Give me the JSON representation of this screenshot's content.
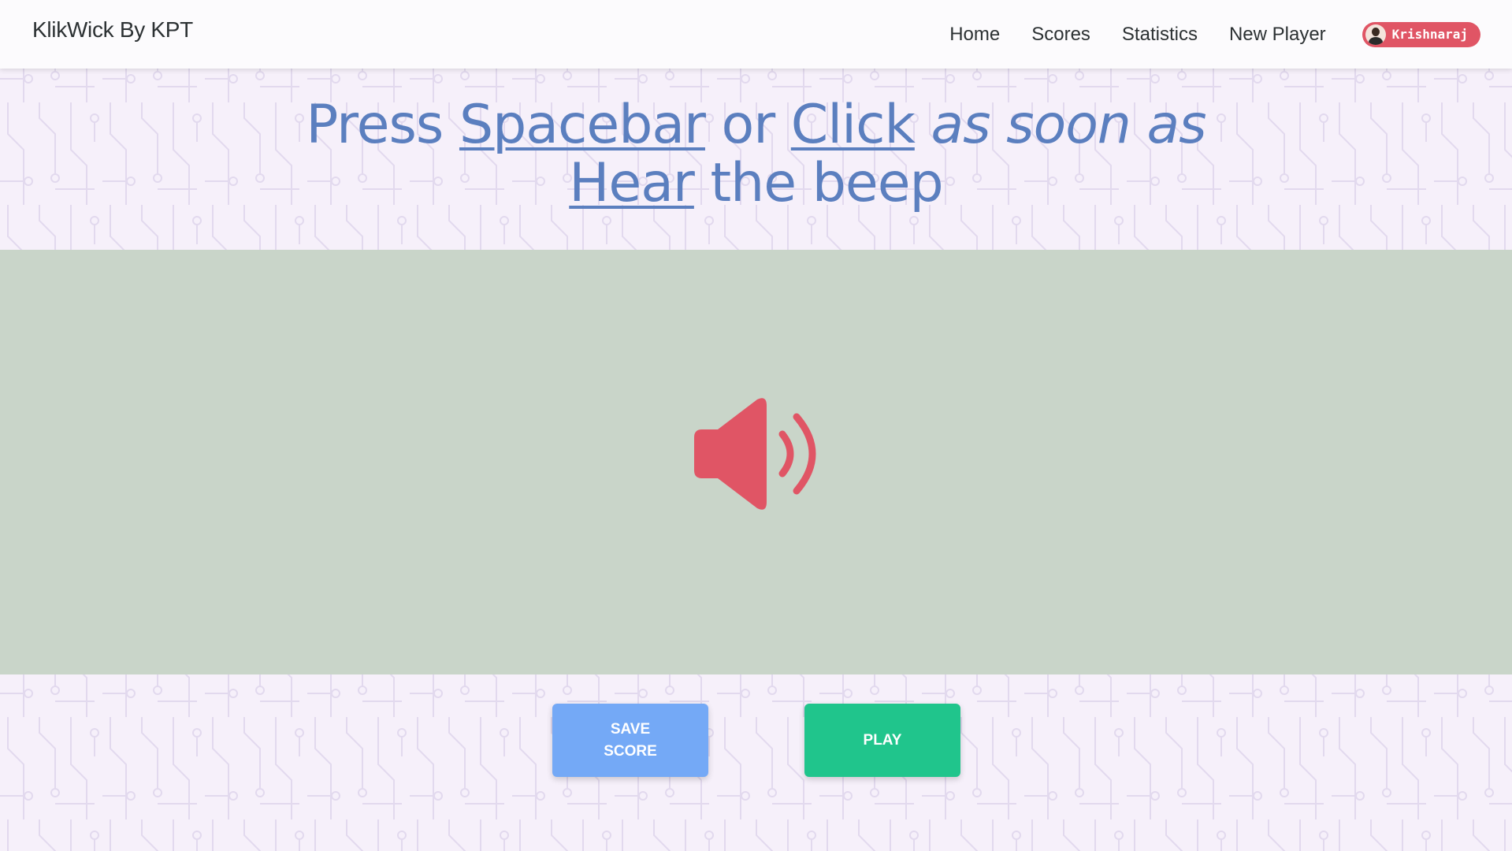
{
  "navbar": {
    "brand": "KlikWick By KPT",
    "links": [
      "Home",
      "Scores",
      "Statistics",
      "New Player"
    ],
    "user": {
      "name": "Krishnaraj",
      "badge_color": "#e05565"
    }
  },
  "headline": {
    "w1": "Press",
    "w2": "Spacebar",
    "w3": "or",
    "w4": "Click",
    "w5": "as soon as",
    "w6": "Hear",
    "w7": "the beep",
    "color": "#5b7fbf"
  },
  "game": {
    "icon": "volume-up-icon",
    "icon_color": "#e05565",
    "background": "#c9d5c9"
  },
  "buttons": {
    "save_score": "SAVE SCORE",
    "play": "PLAY"
  },
  "colors": {
    "page_background": "#f6f0fa",
    "save_button": "#74a9f6",
    "play_button": "#20c58c"
  }
}
